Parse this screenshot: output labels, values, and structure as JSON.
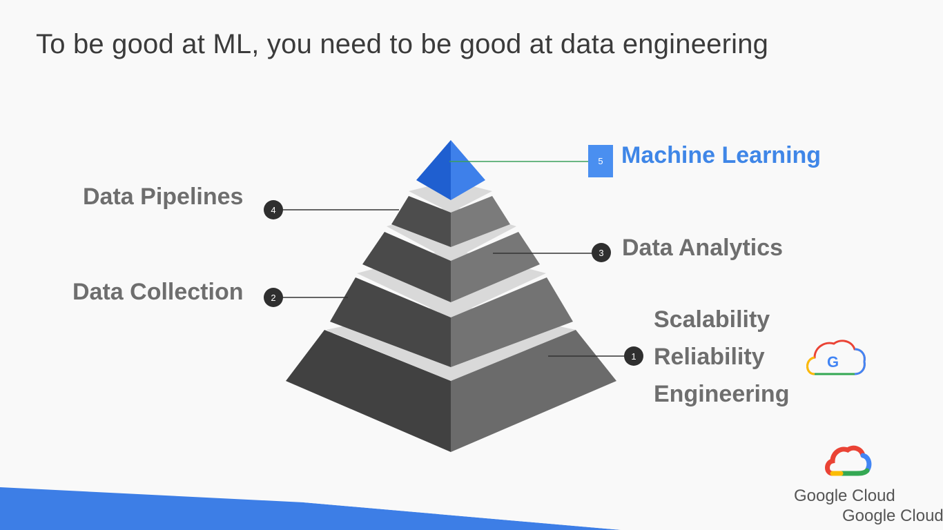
{
  "slide": {
    "title": "To be good at ML, you need to be good at data engineering",
    "layers": [
      {
        "number": "5",
        "label": "Machine Learning"
      },
      {
        "number": "4",
        "label": "Data Pipelines"
      },
      {
        "number": "3",
        "label": "Data Analytics"
      },
      {
        "number": "2",
        "label": "Data Collection"
      },
      {
        "number": "1",
        "label_lines": [
          "Scalability",
          "Reliability",
          "Engineering"
        ]
      }
    ],
    "logo_text": "Google Cloud",
    "logo_text_2": "Google Cloud",
    "icons": [
      "google-cloud-g-icon",
      "google-cloud-logo-icon"
    ],
    "colors": {
      "accent": "#3f86e7",
      "label": "#6e6e6e",
      "badge": "#2f2f2f",
      "banner": "#3d7ee6"
    }
  }
}
